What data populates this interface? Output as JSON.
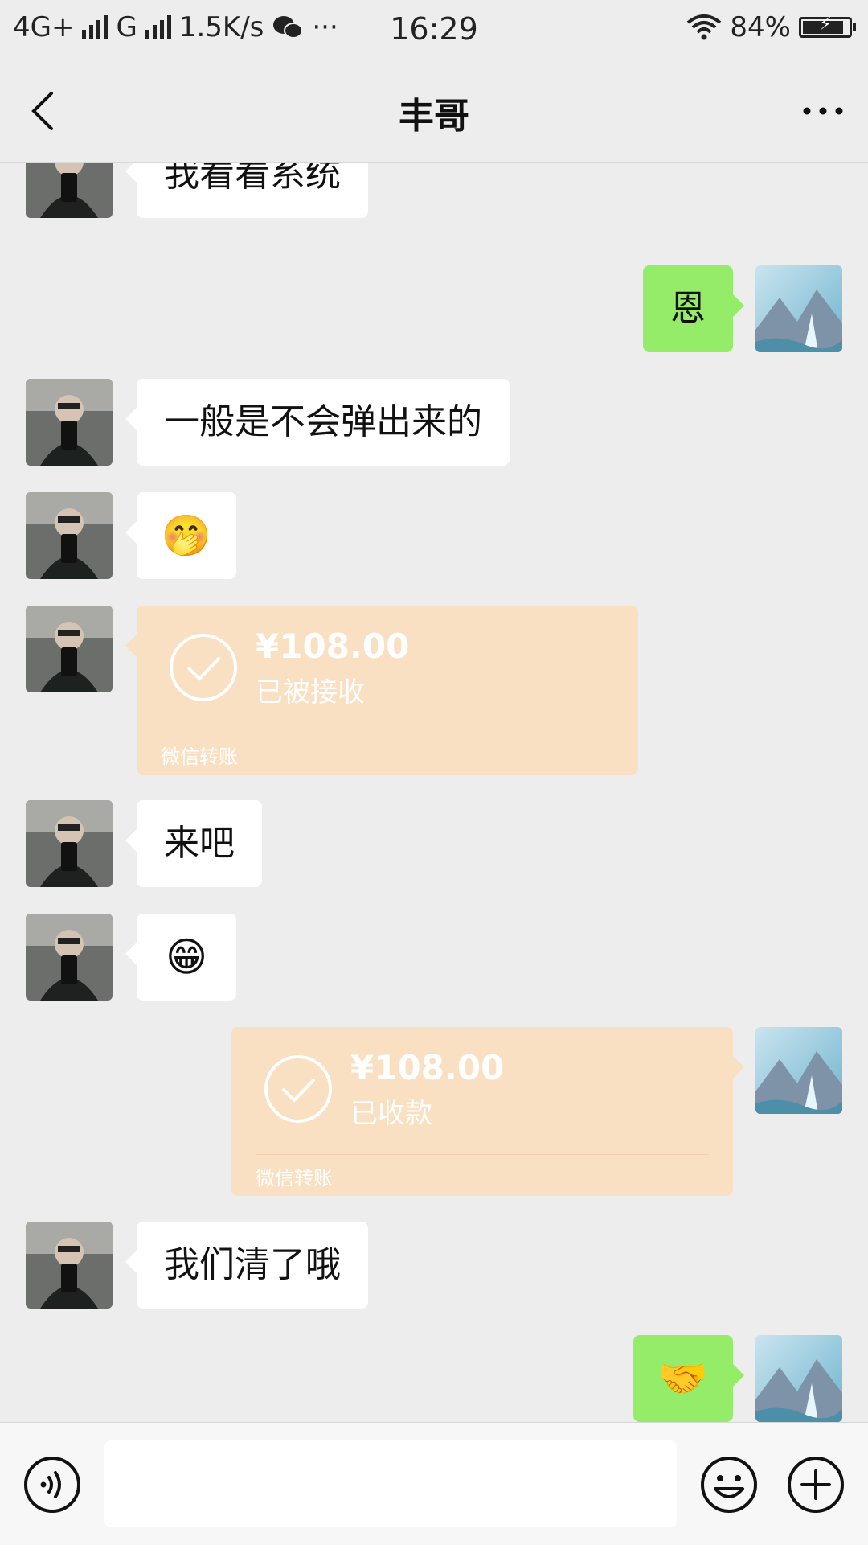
{
  "status_bar": {
    "network1": "4G+",
    "network2": "G",
    "speed": "1.5K/s",
    "more": "···",
    "time": "16:29",
    "battery": "84%"
  },
  "nav": {
    "title": "丰哥"
  },
  "messages": [
    {
      "side": "left",
      "type": "text",
      "text": "我看看系统"
    },
    {
      "side": "right",
      "type": "text",
      "text": "恩"
    },
    {
      "side": "left",
      "type": "text",
      "text": "一般是不会弹出来的"
    },
    {
      "side": "left",
      "type": "emoji",
      "text": "🤭",
      "icon": "covering-mouth-emoji"
    },
    {
      "side": "left",
      "type": "transfer",
      "amount": "¥108.00",
      "status": "已被接收",
      "label": "微信转账"
    },
    {
      "side": "left",
      "type": "text",
      "text": "来吧"
    },
    {
      "side": "left",
      "type": "emoji",
      "text": "😁",
      "icon": "grin-emoji"
    },
    {
      "side": "right",
      "type": "transfer",
      "amount": "¥108.00",
      "status": "已收款",
      "label": "微信转账"
    },
    {
      "side": "left",
      "type": "text",
      "text": "我们清了哦"
    },
    {
      "side": "right",
      "type": "emoji",
      "text": "🤝",
      "icon": "handshake-emoji"
    }
  ],
  "input_bar": {
    "voice_icon": "voice-icon",
    "emoji_icon": "smiley-icon",
    "plus_icon": "plus-icon",
    "value": ""
  },
  "colors": {
    "background": "#ededed",
    "sent_bubble": "#95ec69",
    "received_bubble": "#ffffff",
    "transfer": "#fae0c2"
  }
}
